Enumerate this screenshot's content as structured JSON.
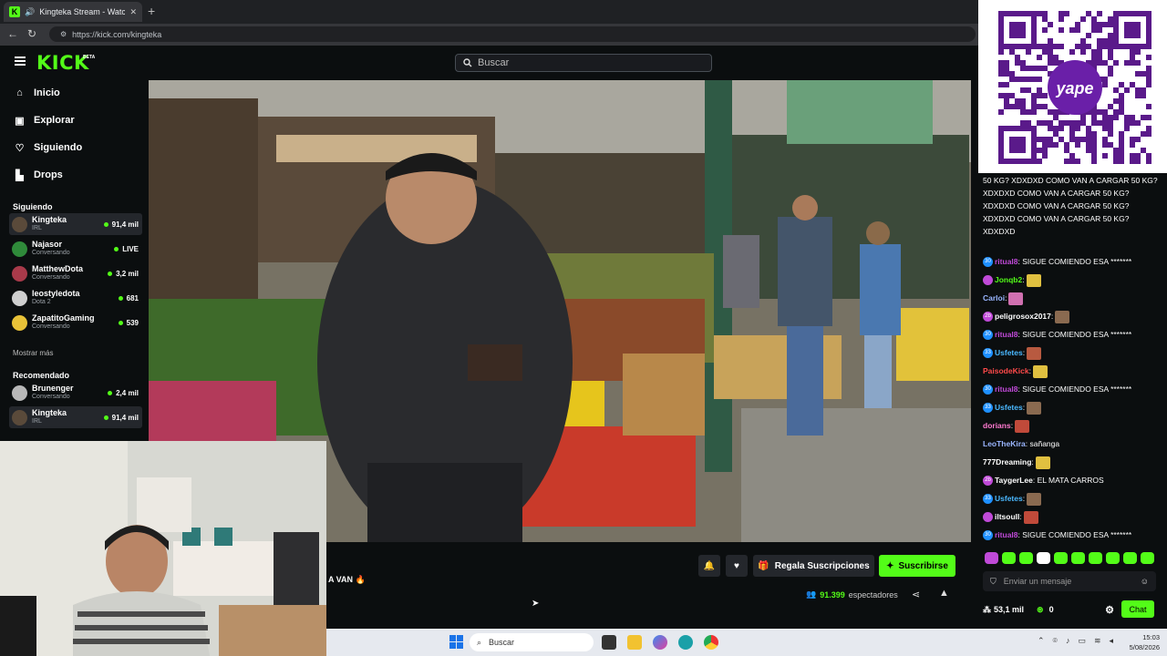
{
  "browser": {
    "tab_title": "Kingteka Stream - Watch Live",
    "close_glyph": "✕",
    "new_tab_glyph": "+",
    "url": "https://kick.com/kingteka"
  },
  "kick": {
    "logo": "KICK",
    "beta": "BETA",
    "search_placeholder": "Buscar"
  },
  "sidebar": {
    "nav": [
      {
        "label": "Inicio",
        "icon": "home-icon"
      },
      {
        "label": "Explorar",
        "icon": "compass-icon"
      },
      {
        "label": "Siguiendo",
        "icon": "heart-icon"
      },
      {
        "label": "Drops",
        "icon": "drops-icon"
      }
    ],
    "following_title": "Siguiendo",
    "following": [
      {
        "name": "Kingteka",
        "sub": "IRL",
        "viewers": "91,4 mil",
        "color": "#5a4a3a"
      },
      {
        "name": "Najasor",
        "sub": "Conversando",
        "viewers": "LIVE",
        "color": "#2f8a3a"
      },
      {
        "name": "MatthewDota",
        "sub": "Conversando",
        "viewers": "3,2 mil",
        "color": "#a83a4a"
      },
      {
        "name": "leostyledota",
        "sub": "Dota 2",
        "viewers": "681",
        "color": "#cfcfcf"
      },
      {
        "name": "ZapatitoGaming",
        "sub": "Conversando",
        "viewers": "539",
        "color": "#e8c238"
      }
    ],
    "show_more": "Mostrar más",
    "recommended_title": "Recomendado",
    "recommended": [
      {
        "name": "Brunenger",
        "sub": "Conversando",
        "viewers": "2,4 mil",
        "color": "#b8b8b8"
      },
      {
        "name": "Kingteka",
        "sub": "IRL",
        "viewers": "91,4 mil",
        "color": "#5a4a3a"
      }
    ]
  },
  "stream": {
    "title_fragment": "A VAN 🔥",
    "gift_label": "Regala Suscripciones",
    "subscribe_label": "Suscribirse",
    "viewers_count": "91.399",
    "viewers_label": "espectadores"
  },
  "chat": {
    "messages": [
      {
        "user": "",
        "text": "50 KG? XDXDXD",
        "user_color": "#ffffff",
        "badge": "",
        "badge_color": ""
      },
      {
        "user": "",
        "text": "COMO VAN A CARGAR 50 KG? XDXDXD",
        "user_color": "#ffffff",
        "badge": "",
        "badge_color": ""
      },
      {
        "user": "",
        "text": "COMO VAN A CARGAR 50 KG? XDXDXD",
        "user_color": "#ffffff",
        "badge": "",
        "badge_color": ""
      },
      {
        "user": "",
        "text": "COMO VAN A CARGAR 50 KG? XDXDXD",
        "user_color": "#ffffff",
        "badge": "",
        "badge_color": ""
      },
      {
        "user": "",
        "text": "COMO VAN A CARGAR 50 KG? XDXDXD",
        "user_color": "#ffffff",
        "badge": "",
        "badge_color": ""
      },
      {
        "user": "ritual8",
        "text": ": SIGUE COMIENDO ESA *******",
        "user_color": "#c04ad8",
        "badge": "30",
        "badge_color": "#1e90ff"
      },
      {
        "user": "Jonqb2",
        "text": ":",
        "user_color": "#53fc18",
        "badge": "",
        "badge_color": "#c04ad8"
      },
      {
        "user": "Carloi",
        "text": ":",
        "user_color": "#9ab6ff",
        "badge": "",
        "badge_color": ""
      },
      {
        "user": "peligrosox2017",
        "text": ":",
        "user_color": "#ffffff",
        "badge": "2b",
        "badge_color": "#c04ad8"
      },
      {
        "user": "ritual8",
        "text": ": SIGUE COMIENDO ESA *******",
        "user_color": "#c04ad8",
        "badge": "30",
        "badge_color": "#1e90ff"
      },
      {
        "user": "Usfetes",
        "text": ":",
        "user_color": "#4ab8ff",
        "badge": "33",
        "badge_color": "#1e90ff"
      },
      {
        "user": "PaisodeKick",
        "text": ":",
        "user_color": "#ff4a4a",
        "badge": "",
        "badge_color": ""
      },
      {
        "user": "ritual8",
        "text": ": SIGUE COMIENDO ESA *******",
        "user_color": "#c04ad8",
        "badge": "30",
        "badge_color": "#1e90ff"
      },
      {
        "user": "Usfetes",
        "text": ":",
        "user_color": "#4ab8ff",
        "badge": "33",
        "badge_color": "#1e90ff"
      },
      {
        "user": "dorians",
        "text": ":",
        "user_color": "#ff7ad0",
        "badge": "",
        "badge_color": ""
      },
      {
        "user": "LeoTheKira",
        "text": ": sañanga",
        "user_color": "#9ab6ff",
        "badge": "",
        "badge_color": ""
      },
      {
        "user": "777Dreaming",
        "text": ":",
        "user_color": "#ffffff",
        "badge": "",
        "badge_color": ""
      },
      {
        "user": "TaygerLee",
        "text": ": EL MATA CARROS",
        "user_color": "#ffffff",
        "badge": "2b",
        "badge_color": "#c04ad8"
      },
      {
        "user": "Usfetes",
        "text": ":",
        "user_color": "#4ab8ff",
        "badge": "33",
        "badge_color": "#1e90ff"
      },
      {
        "user": "iltsoull",
        "text": ":",
        "user_color": "#ffffff",
        "badge": "",
        "badge_color": "#c04ad8"
      },
      {
        "user": "ritual8",
        "text": ": SIGUE COMIENDO ESA *******",
        "user_color": "#c04ad8",
        "badge": "30",
        "badge_color": "#1e90ff"
      }
    ],
    "input_placeholder": "Enviar un mensaje",
    "points": "53,1 mil",
    "coins": "0",
    "chat_button": "Chat",
    "qr_brand": "yape"
  },
  "taskbar": {
    "search_placeholder": "Buscar",
    "time": "15:03",
    "date": "5/08/2026"
  },
  "colors": {
    "kick_green": "#53fc18",
    "background": "#0b0e0f"
  }
}
